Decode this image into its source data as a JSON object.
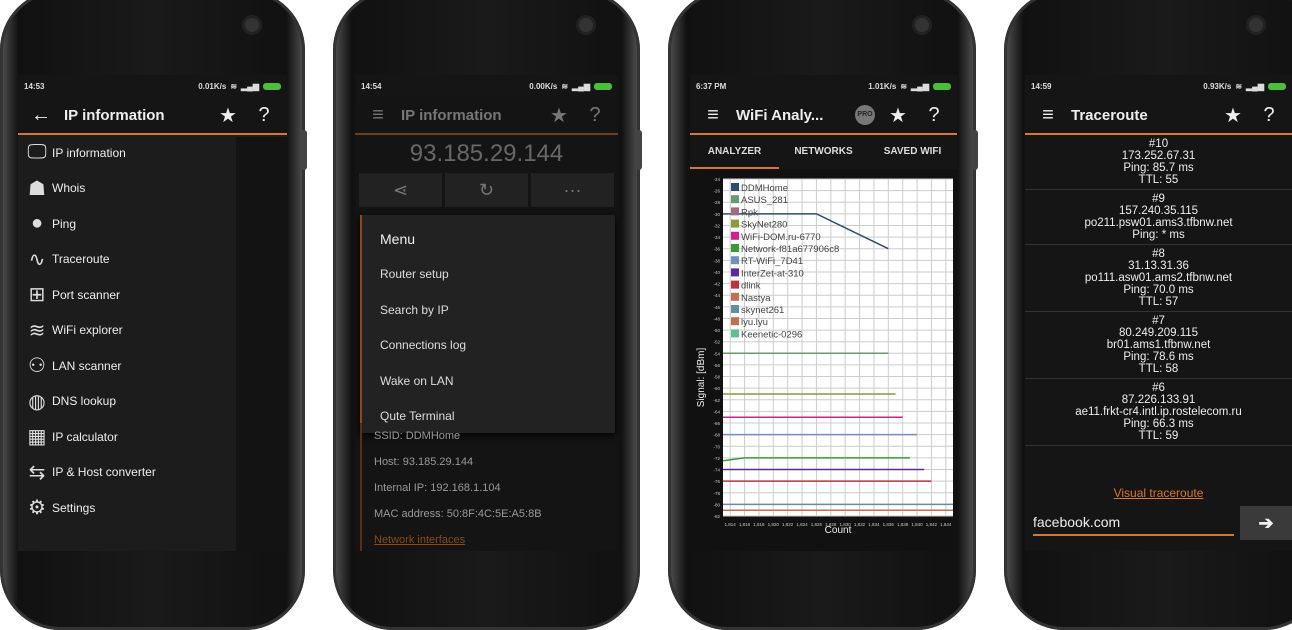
{
  "status_icons": [
    "signal-dots-icon",
    "sync-off-icon",
    "wifi-icon",
    "cell-signal-icon",
    "battery-icon"
  ],
  "accent": "#d9772a",
  "phone1": {
    "time": "14:53",
    "speed": "0.01K/s",
    "title": "IP information",
    "items": [
      {
        "label": "IP information",
        "icon": "monitor-icon"
      },
      {
        "label": "Whois",
        "icon": "people-icon"
      },
      {
        "label": "Ping",
        "icon": "ping-pong-icon"
      },
      {
        "label": "Traceroute",
        "icon": "route-icon"
      },
      {
        "label": "Port scanner",
        "icon": "network-icon"
      },
      {
        "label": "WiFi explorer",
        "icon": "wifi-icon"
      },
      {
        "label": "LAN scanner",
        "icon": "lan-icon"
      },
      {
        "label": "DNS lookup",
        "icon": "globe-icon"
      },
      {
        "label": "IP calculator",
        "icon": "calculator-icon"
      },
      {
        "label": "IP & Host converter",
        "icon": "signpost-icon"
      },
      {
        "label": "Settings",
        "icon": "gear-icon"
      }
    ]
  },
  "phone2": {
    "time": "14:54",
    "speed": "0.00K/s",
    "title": "IP information",
    "ip": "93.185.29.144",
    "menu_title": "Menu",
    "menu": [
      "Router setup",
      "Search by IP",
      "Connections log",
      "Wake on LAN",
      "Qute Terminal"
    ],
    "info": [
      "SSID: DDMHome",
      "Host: 93.185.29.144",
      "Internal IP: 192.168.1.104",
      "MAC address: 50:8F:4C:5E:A5:8B"
    ],
    "link": "Network interfaces"
  },
  "phone3": {
    "time": "6:37 PM",
    "speed": "1.01K/s",
    "title": "WiFi Analy...",
    "pro": "PRO",
    "tabs": [
      "ANALYZER",
      "NETWORKS",
      "SAVED WIFI"
    ]
  },
  "chart_data": {
    "type": "line",
    "xlabel": "Count",
    "ylabel": "Signal: [dBm]",
    "ylim": [
      -82,
      -24
    ],
    "xlim": [
      1813,
      1845
    ],
    "yticks": [
      -24,
      -26,
      -28,
      -30,
      -32,
      -34,
      -36,
      -38,
      -40,
      -42,
      -44,
      -46,
      -48,
      -50,
      -52,
      -54,
      -56,
      -58,
      -60,
      -62,
      -64,
      -66,
      -68,
      -70,
      -72,
      -74,
      -76,
      -78,
      -80,
      -82
    ],
    "xticks": [
      "1,814",
      "1,816",
      "1,818",
      "1,820",
      "1,822",
      "1,824",
      "1,826",
      "1,828",
      "1,830",
      "1,832",
      "1,834",
      "1,836",
      "1,838",
      "1,840",
      "1,842",
      "1,844"
    ],
    "grid": true,
    "legend": "top-left",
    "series": [
      {
        "name": "DDMHome",
        "color": "#2b4d70",
        "x": [
          1813,
          1826,
          1836
        ],
        "y": [
          -30,
          -30,
          -36
        ]
      },
      {
        "name": "ASUS_281",
        "color": "#6a9a6a",
        "x": [
          1813,
          1836
        ],
        "y": [
          -54,
          -54
        ]
      },
      {
        "name": "Rpk",
        "color": "#a06a84",
        "x": [],
        "y": []
      },
      {
        "name": "SkyNet280",
        "color": "#8a9a3a",
        "x": [
          1813,
          1837
        ],
        "y": [
          -61,
          -61
        ]
      },
      {
        "name": "WiFi-DOM.ru-6770",
        "color": "#d0208a",
        "x": [
          1813,
          1838
        ],
        "y": [
          -65,
          -65
        ]
      },
      {
        "name": "Network-f81a677906c8",
        "color": "#3a9a3a",
        "x": [
          1813,
          1816,
          1839
        ],
        "y": [
          -72.5,
          -72,
          -72
        ]
      },
      {
        "name": "RT-WiFi_7D41",
        "color": "#7090c0",
        "x": [
          1813,
          1840
        ],
        "y": [
          -68,
          -68
        ]
      },
      {
        "name": "InterZet-at-310",
        "color": "#5a2a9a",
        "x": [
          1813,
          1841
        ],
        "y": [
          -74,
          -74
        ]
      },
      {
        "name": "dlink",
        "color": "#c03040",
        "x": [
          1813,
          1842
        ],
        "y": [
          -76,
          -76
        ]
      },
      {
        "name": "Nastya",
        "color": "#c07050",
        "x": [
          1813,
          1845
        ],
        "y": [
          -81,
          -81
        ]
      },
      {
        "name": "skynet261",
        "color": "#6090a0",
        "x": [
          1813,
          1845
        ],
        "y": [
          -80,
          -80
        ]
      },
      {
        "name": "lyu.lyu",
        "color": "#c0704a",
        "x": [],
        "y": []
      },
      {
        "name": "Keenetic-0296",
        "color": "#60c090",
        "x": [],
        "y": []
      }
    ]
  },
  "phone4": {
    "time": "14:59",
    "speed": "0.93K/s",
    "title": "Traceroute",
    "hops": [
      {
        "n": "#10",
        "lines": [
          "173.252.67.31",
          "Ping: 85.7 ms",
          "TTL: 55"
        ]
      },
      {
        "n": "#9",
        "lines": [
          "157.240.35.115",
          "po211.psw01.ams3.tfbnw.net",
          "Ping: * ms"
        ]
      },
      {
        "n": "#8",
        "lines": [
          "31.13.31.36",
          "po111.asw01.ams2.tfbnw.net",
          "Ping: 70.0 ms",
          "TTL: 57"
        ]
      },
      {
        "n": "#7",
        "lines": [
          "80.249.209.115",
          "br01.ams1.tfbnw.net",
          "Ping: 78.6 ms",
          "TTL: 58"
        ]
      },
      {
        "n": "#6",
        "lines": [
          "87.226.133.91",
          "ae11.frkt-cr4.intl.ip.rostelecom.ru",
          "Ping: 66.3 ms",
          "TTL: 59"
        ]
      }
    ],
    "link": "Visual traceroute",
    "input": "facebook.com"
  }
}
